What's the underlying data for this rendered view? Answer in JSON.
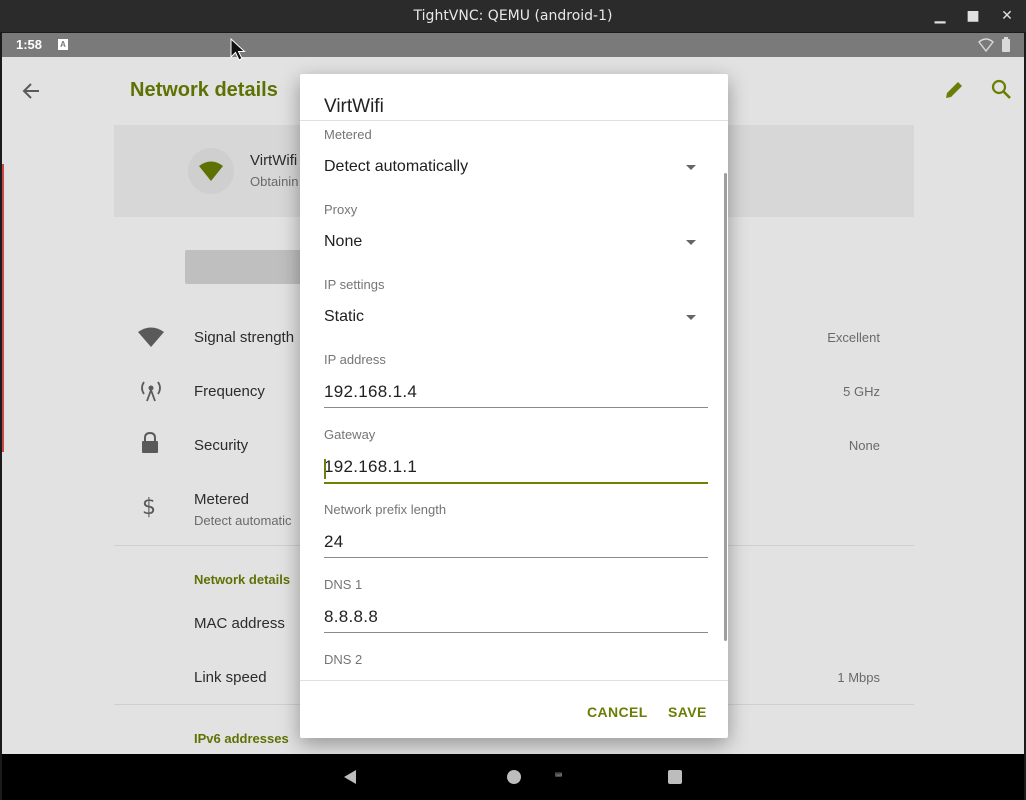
{
  "window": {
    "title": "TightVNC: QEMU (android-1)",
    "minimize_glyph": "▁",
    "maximize_glyph": "■",
    "close_glyph": "✕"
  },
  "status_bar": {
    "time": "1:58",
    "notification_glyph": "A"
  },
  "app_bar": {
    "title": "Network details",
    "back_icon": "arrow-left-icon",
    "edit_icon": "pencil-icon",
    "search_icon": "search-icon"
  },
  "background": {
    "network_name": "VirtWifi",
    "network_status": "Obtainin",
    "rows": [
      {
        "label": "Signal strength",
        "value": "Excellent",
        "icon": "wifi-icon"
      },
      {
        "label": "Frequency",
        "value": "5 GHz",
        "icon": "antenna-icon"
      },
      {
        "label": "Security",
        "value": "None",
        "icon": "lock-icon"
      },
      {
        "label": "Metered",
        "sub": "Detect automatic",
        "icon": "dollar-icon"
      }
    ],
    "section_network_details": "Network details",
    "mac_label": "MAC address",
    "link_speed_label": "Link speed",
    "link_speed_value": "1 Mbps",
    "section_ipv6": "IPv6 addresses"
  },
  "dialog": {
    "title": "VirtWifi",
    "metered": {
      "label": "Metered",
      "value": "Detect automatically"
    },
    "proxy": {
      "label": "Proxy",
      "value": "None"
    },
    "ip_settings": {
      "label": "IP settings",
      "value": "Static"
    },
    "ip_address": {
      "label": "IP address",
      "value": "192.168.1.4"
    },
    "gateway": {
      "label": "Gateway",
      "value": "192.168.1.1"
    },
    "prefix": {
      "label": "Network prefix length",
      "value": "24"
    },
    "dns1": {
      "label": "DNS 1",
      "value": "8.8.8.8"
    },
    "dns2": {
      "label": "DNS 2"
    },
    "cancel_label": "CANCEL",
    "save_label": "SAVE"
  },
  "colors": {
    "accent": "#6b7d04",
    "title_accent": "#5e7204",
    "scrim_bg": "#e2e2e2",
    "dialog_bg": "#ffffff"
  }
}
